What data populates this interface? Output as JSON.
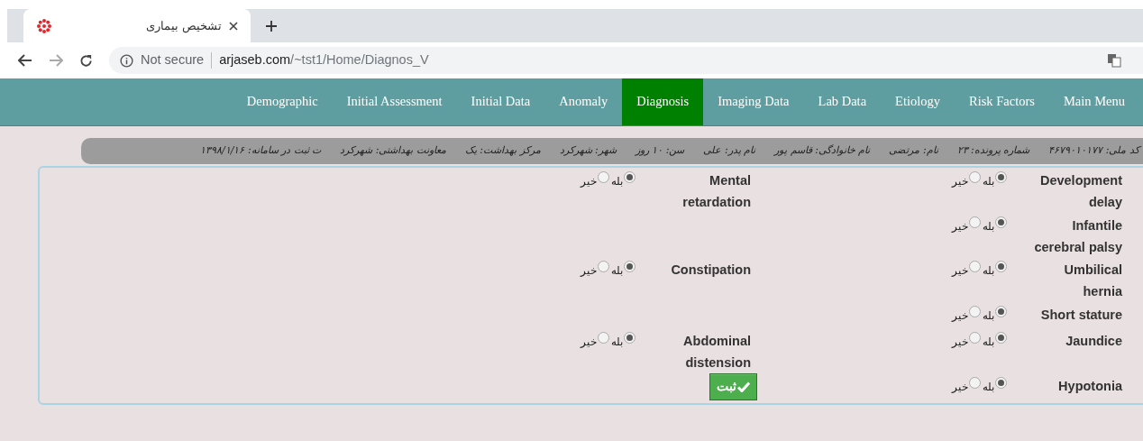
{
  "browser": {
    "tab_title": "تشخیص بیماری",
    "security": "Not secure",
    "url_host": "arjaseb.com",
    "url_path": "/~tst1/Home/Diagnos_V"
  },
  "nav": [
    {
      "label": "Main Menu",
      "selected": false
    },
    {
      "label": "Risk Factors",
      "selected": false
    },
    {
      "label": "Etiology",
      "selected": false
    },
    {
      "label": "Lab Data",
      "selected": false
    },
    {
      "label": "Imaging Data",
      "selected": false
    },
    {
      "label": "Diagnosis",
      "selected": true
    },
    {
      "label": "Anomaly",
      "selected": false
    },
    {
      "label": "Initial Data",
      "selected": false
    },
    {
      "label": "Initial Assessment",
      "selected": false
    },
    {
      "label": "Demographic",
      "selected": false
    }
  ],
  "patient_info": [
    "کد ملی: ۴۶۷۹۰۱۰۱۷۷",
    "شماره پرونده: ۲۳",
    "نام: مرتضی",
    "نام خانوادگی: قاسم پور",
    "نام پدر: علی",
    "سن: ۱۰ روز",
    "شهر: شهرکرد",
    "مرکز بهداشت: یک",
    "معاونت بهداشتی: شهرکرد",
    "ت ثبت در سامانه: ۱۳۹۸/۱/۱۶"
  ],
  "rows": [
    {
      "cells": [
        {
          "kind": "question",
          "label": "Development delay",
          "options": [
            {
              "label": "بله",
              "selected": true
            },
            {
              "label": "خیر",
              "selected": false
            }
          ]
        },
        {
          "kind": "question",
          "label": "Mental retardation",
          "options": [
            {
              "label": "بله",
              "selected": true
            },
            {
              "label": "خیر",
              "selected": false
            }
          ]
        }
      ]
    },
    {
      "cells": [
        {
          "kind": "question",
          "label": "Infantile cerebral palsy",
          "options": [
            {
              "label": "بله",
              "selected": true
            },
            {
              "label": "خیر",
              "selected": false
            }
          ]
        }
      ]
    },
    {
      "cells": [
        {
          "kind": "question",
          "label": "Umbilical hernia",
          "options": [
            {
              "label": "بله",
              "selected": true
            },
            {
              "label": "خیر",
              "selected": false
            }
          ]
        },
        {
          "kind": "question",
          "label": "Constipation",
          "options": [
            {
              "label": "بله",
              "selected": true
            },
            {
              "label": "خیر",
              "selected": false
            }
          ]
        }
      ]
    },
    {
      "cells": [
        {
          "kind": "question",
          "label": "Short stature",
          "options": [
            {
              "label": "بله",
              "selected": true
            },
            {
              "label": "خیر",
              "selected": false
            }
          ]
        }
      ]
    },
    {
      "cells": [
        {
          "kind": "question",
          "label": "Jaundice",
          "options": [
            {
              "label": "بله",
              "selected": true
            },
            {
              "label": "خیر",
              "selected": false
            }
          ]
        },
        {
          "kind": "question",
          "label": "Abdominal distension",
          "options": [
            {
              "label": "بله",
              "selected": true
            },
            {
              "label": "خیر",
              "selected": false
            }
          ]
        }
      ]
    },
    {
      "cells": [
        {
          "kind": "question",
          "label": "Hypotonia",
          "options": [
            {
              "label": "بله",
              "selected": true
            },
            {
              "label": "خیر",
              "selected": false
            }
          ]
        },
        {
          "kind": "submit",
          "label": "ثبت"
        }
      ]
    }
  ]
}
